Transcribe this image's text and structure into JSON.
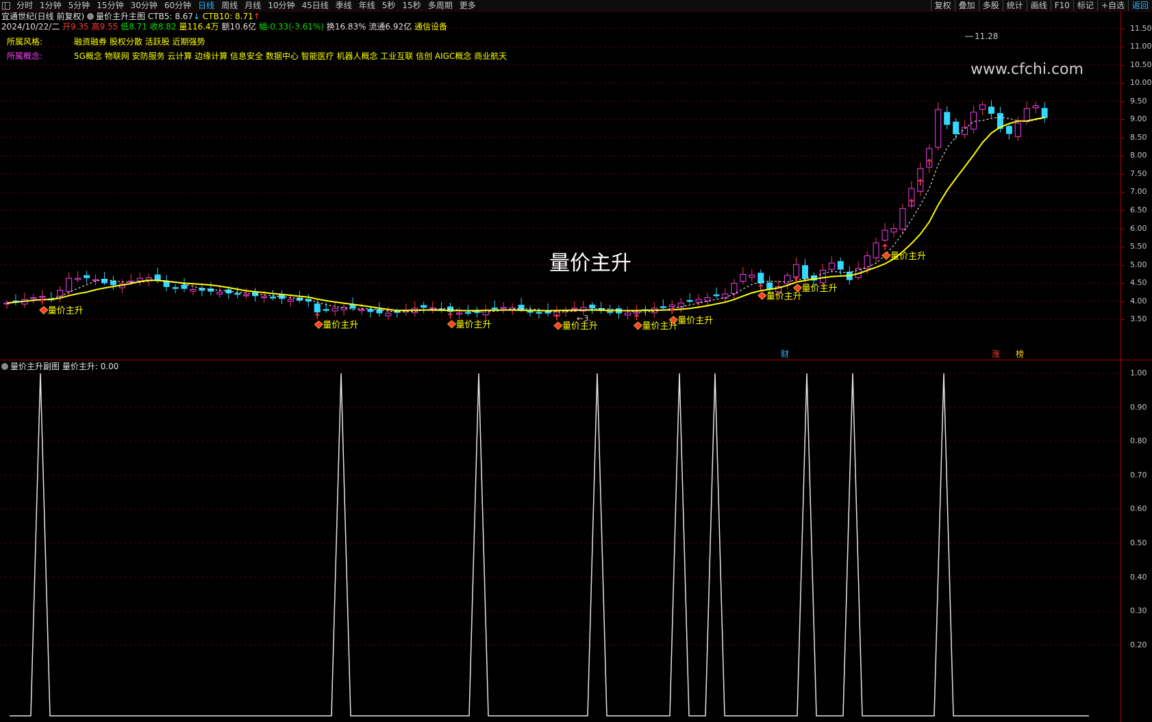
{
  "toolbar": {
    "periods": [
      "分时",
      "1分钟",
      "5分钟",
      "15分钟",
      "30分钟",
      "60分钟",
      "日线",
      "周线",
      "月线",
      "10分钟",
      "45日线",
      "季线",
      "年线",
      "5秒",
      "15秒",
      "多周期",
      "更多"
    ],
    "active_period": "日线",
    "right_buttons": [
      "复权",
      "叠加",
      "多股",
      "统计",
      "画线",
      "F10",
      "标记",
      "+自选",
      "返回"
    ]
  },
  "header": {
    "stock_title": "宜通世纪(日线 前复权)",
    "indicator_name": "量价主升主图",
    "ctb5_label": "CTB5:",
    "ctb5_value": "8.67",
    "ctb5_arrow": "↓",
    "ctb10_label": "CTB10:",
    "ctb10_value": "8.71",
    "ctb10_arrow": "↑",
    "date": "2024/10/22/二",
    "open_label": "开",
    "open": "9.35",
    "high_label": "高",
    "high": "9.55",
    "low_label": "低",
    "low": "8.71",
    "close_label": "收",
    "close": "8.82",
    "volume_label": "量",
    "volume": "116.4万",
    "amount_label": "额",
    "amount": "10.6亿",
    "change_label": "幅",
    "change": "-0.33(-3.61%)",
    "turnover_label": "换",
    "turnover": "16.83%",
    "float_label": "流通",
    "float_value": "6.92亿",
    "industry": "通信设备",
    "style_label": "所属风格:",
    "style_values": "融资融券 股权分散 活跃股 近期强势",
    "concept_label": "所属概念:",
    "concept_values": "5G概念 物联网 安防服务 云计算 边缘计算 信息安全 数据中心 智能医疗 机器人概念 工业互联 信创 AIGC概念 商业航天"
  },
  "main_chart": {
    "center_title": "量价主升",
    "watermark": "www.cfchi.com",
    "max_label": "11.28",
    "min_label": "3.",
    "signal_label": "量价主升",
    "badges": [
      "财",
      "涨",
      "榜"
    ],
    "y_ticks": [
      "11.50",
      "11.00",
      "10.50",
      "10.00",
      "9.50",
      "9.00",
      "8.50",
      "8.00",
      "7.50",
      "7.00",
      "6.50",
      "6.00",
      "5.50",
      "5.00",
      "4.50",
      "4.00",
      "3.50"
    ],
    "colors": {
      "up": "#ff3cff",
      "down": "#33d7ff",
      "ma": "#ffff00",
      "grid": "#5a0000"
    }
  },
  "sub_chart": {
    "title": "量价主升副图",
    "value_label": "量价主升:",
    "value": "0.00",
    "y_ticks": [
      "1.00",
      "0.90",
      "0.80",
      "0.70",
      "0.60",
      "0.50",
      "0.40",
      "0.30",
      "0.20"
    ]
  }
}
